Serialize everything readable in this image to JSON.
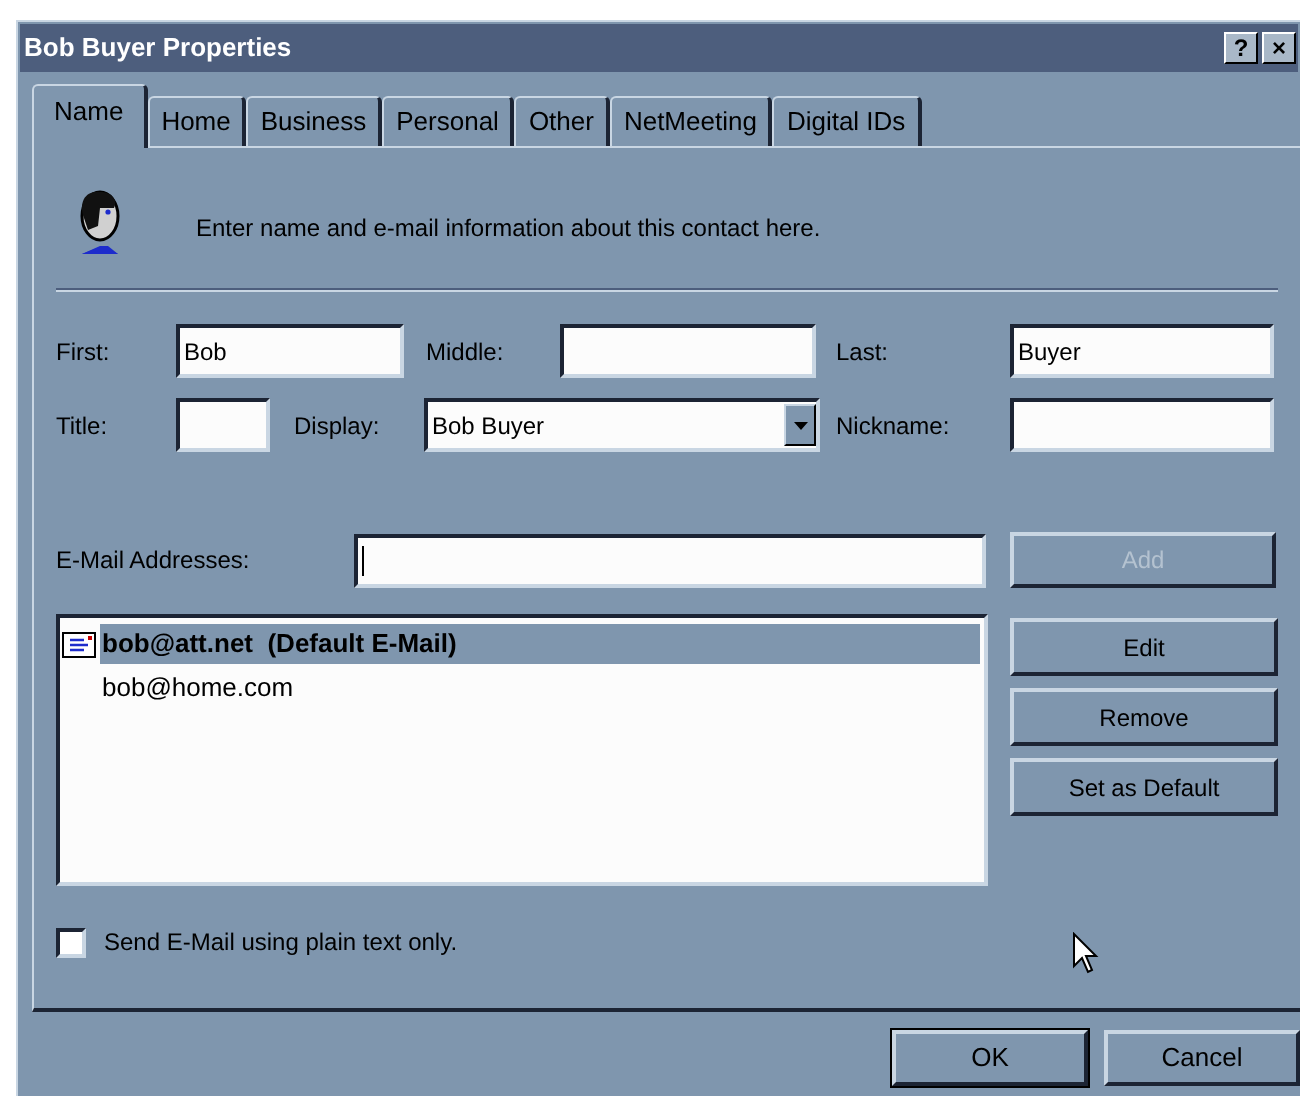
{
  "window": {
    "title": "Bob Buyer Properties",
    "title_buttons": [
      "?",
      "×"
    ]
  },
  "tabs": [
    {
      "label": "Name",
      "selected": true
    },
    {
      "label": "Home",
      "selected": false
    },
    {
      "label": "Business",
      "selected": false
    },
    {
      "label": "Personal",
      "selected": false
    },
    {
      "label": "Other",
      "selected": false
    },
    {
      "label": "NetMeeting",
      "selected": false
    },
    {
      "label": "Digital IDs",
      "selected": false
    }
  ],
  "intro": "Enter name and e-mail information about this contact here.",
  "name_rows": [
    [
      {
        "label": "First:",
        "value": "Bob",
        "kind": "text"
      },
      {
        "label": "Middle:",
        "kind": "text"
      },
      {
        "label": "Last:",
        "value": "Buyer",
        "kind": "text"
      }
    ],
    [
      {
        "label": "Title:",
        "kind": "text"
      },
      {
        "label": "Display:",
        "value": "Bob Buyer",
        "kind": "dropdown"
      },
      {
        "label": "Nickname:",
        "kind": "text"
      }
    ]
  ],
  "email_entry": {
    "label": "E-Mail Addresses:",
    "focused": true,
    "button": {
      "label": "Add",
      "disabled": true
    }
  },
  "email_list": [
    {
      "text": "bob@att.net  (Default E-Mail)",
      "default": true,
      "selected": true
    },
    {
      "text": "bob@home.com",
      "default": false,
      "selected": false
    }
  ],
  "list_buttons": [
    "Edit",
    "Remove",
    "Set as Default"
  ],
  "plain_text_option": {
    "label": "Send E-Mail using plain text only.",
    "checked": false
  },
  "footer_buttons": [
    "OK",
    "Cancel"
  ]
}
